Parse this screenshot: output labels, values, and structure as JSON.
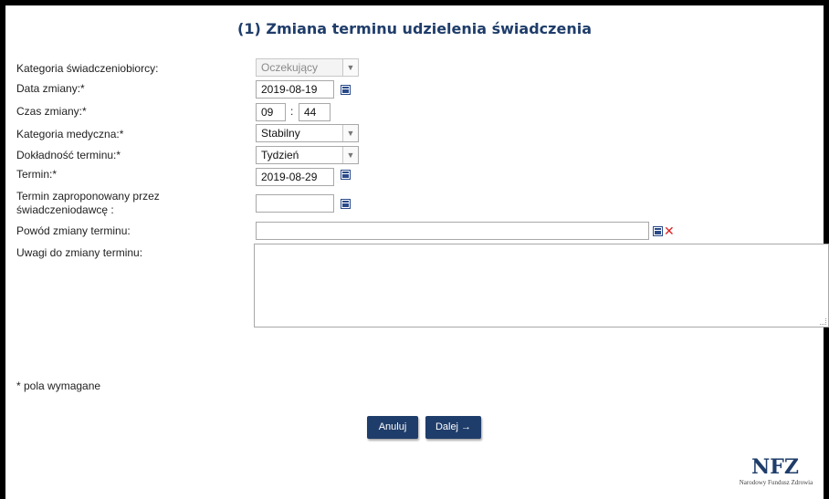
{
  "title": "(1) Zmiana terminu udzielenia świadczenia",
  "form": {
    "kategoria_label": "Kategoria świadczeniobiorcy:",
    "kategoria_value": "Oczekujący",
    "data_zmiany_label": "Data zmiany:*",
    "data_zmiany_value": "2019-08-19",
    "czas_zmiany_label": "Czas zmiany:*",
    "czas_hour": "09",
    "czas_minute": "44",
    "czas_separator": ":",
    "kategoria_medyczna_label": "Kategoria medyczna:*",
    "kategoria_medyczna_value": "Stabilny",
    "dokladnosc_label": "Dokładność terminu:*",
    "dokladnosc_value": "Tydzień",
    "termin_label": "Termin:*",
    "termin_value": "2019-08-29",
    "termin_proponowany_label_line1": "Termin zaproponowany przez",
    "termin_proponowany_label_line2": "świadczeniodawcę :",
    "termin_proponowany_value": "",
    "powod_label": "Powód zmiany terminu:",
    "powod_value": "",
    "uwagi_label": "Uwagi do zmiany terminu:",
    "uwagi_value": ""
  },
  "required_note": "* pola wymagane",
  "buttons": {
    "cancel": "Anuluj",
    "next": "Dalej →"
  },
  "logo": {
    "main": "NFZ",
    "sub": "Narodowy Fundusz Zdrowia"
  },
  "icons": {
    "calendar": "calendar-icon",
    "clear": "clear-icon",
    "dropdown": "chevron-down-icon"
  },
  "colors": {
    "accent": "#1f3d6a",
    "clear": "#dd2222"
  }
}
